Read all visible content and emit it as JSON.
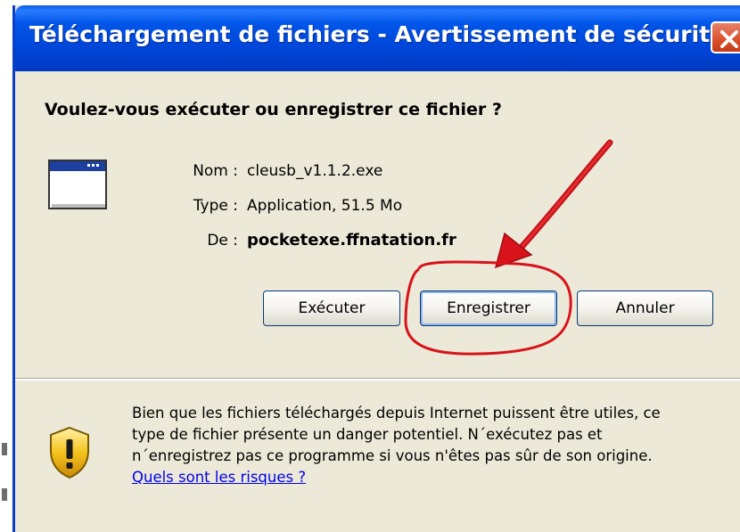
{
  "dialog": {
    "title": "Téléchargement de fichiers - Avertissement de sécurité",
    "question": "Voulez-vous exécuter ou enregistrer ce fichier ?",
    "file": {
      "name_label": "Nom :",
      "name_value": "cleusb_v1.1.2.exe",
      "type_label": "Type :",
      "type_value": "Application, 51.5 Mo",
      "from_label": "De :",
      "from_value": "pocketexe.ffnatation.fr"
    },
    "buttons": {
      "run": "Exécuter",
      "save": "Enregistrer",
      "cancel": "Annuler"
    },
    "warning": {
      "line1": "Bien que les fichiers téléchargés depuis Internet puissent être utiles, ce",
      "line2": "type de fichier présente un danger potentiel. N´exécutez pas et",
      "line3": "n´enregistrez pas ce programme si vous n'êtes pas sûr de son origine.",
      "link": "Quels sont les risques ?"
    }
  },
  "icons": {
    "close": "close-icon",
    "application": "application-window-icon",
    "warning": "warning-shield-icon"
  },
  "colors": {
    "titlebar": "#0055e8",
    "dialog_bg": "#ece9d8",
    "annotation": "#e0161d",
    "link": "#0000ee"
  }
}
